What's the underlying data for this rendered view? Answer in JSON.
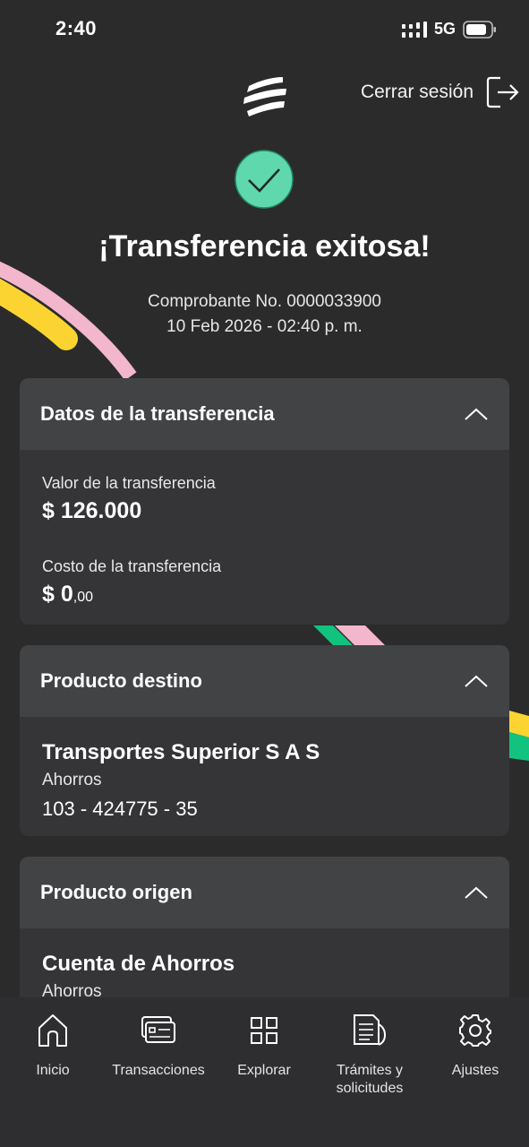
{
  "status_bar": {
    "time": "2:40",
    "network": "5G"
  },
  "header": {
    "logout_label": "Cerrar sesión"
  },
  "success": {
    "title": "¡Transferencia exitosa!",
    "receipt_number": "Comprobante No. 0000033900",
    "date": "10 Feb 2026 - 02:40 p. m."
  },
  "transfer_card": {
    "title": "Datos de la transferencia",
    "value_label": "Valor de la transferencia",
    "value_amount": "$ 126.000",
    "cost_label": "Costo de la transferencia",
    "cost_amount": "$ 0",
    "cost_cents": ",00"
  },
  "destination_card": {
    "title": "Producto destino",
    "name": "Transportes Superior S A S",
    "type": "Ahorros",
    "number": "103 - 424775 - 35"
  },
  "origin_card": {
    "title": "Producto origen",
    "name": "Cuenta de Ahorros",
    "type": "Ahorros"
  },
  "bottom_nav": {
    "items": [
      {
        "label": "Inicio",
        "icon": "home-icon"
      },
      {
        "label": "Transacciones",
        "icon": "transactions-icon"
      },
      {
        "label": "Explorar",
        "icon": "grid-icon"
      },
      {
        "label": "Trámites y solicitudes",
        "icon": "document-icon"
      },
      {
        "label": "Ajustes",
        "icon": "gear-icon"
      }
    ]
  },
  "colors": {
    "background": "#2c2b2b",
    "card": "#353537",
    "card_header": "#424345",
    "success_green": "#5fd8ae",
    "ribbon_pink": "#f2b7cc",
    "ribbon_yellow": "#fcd432",
    "ribbon_green": "#11c37f"
  }
}
